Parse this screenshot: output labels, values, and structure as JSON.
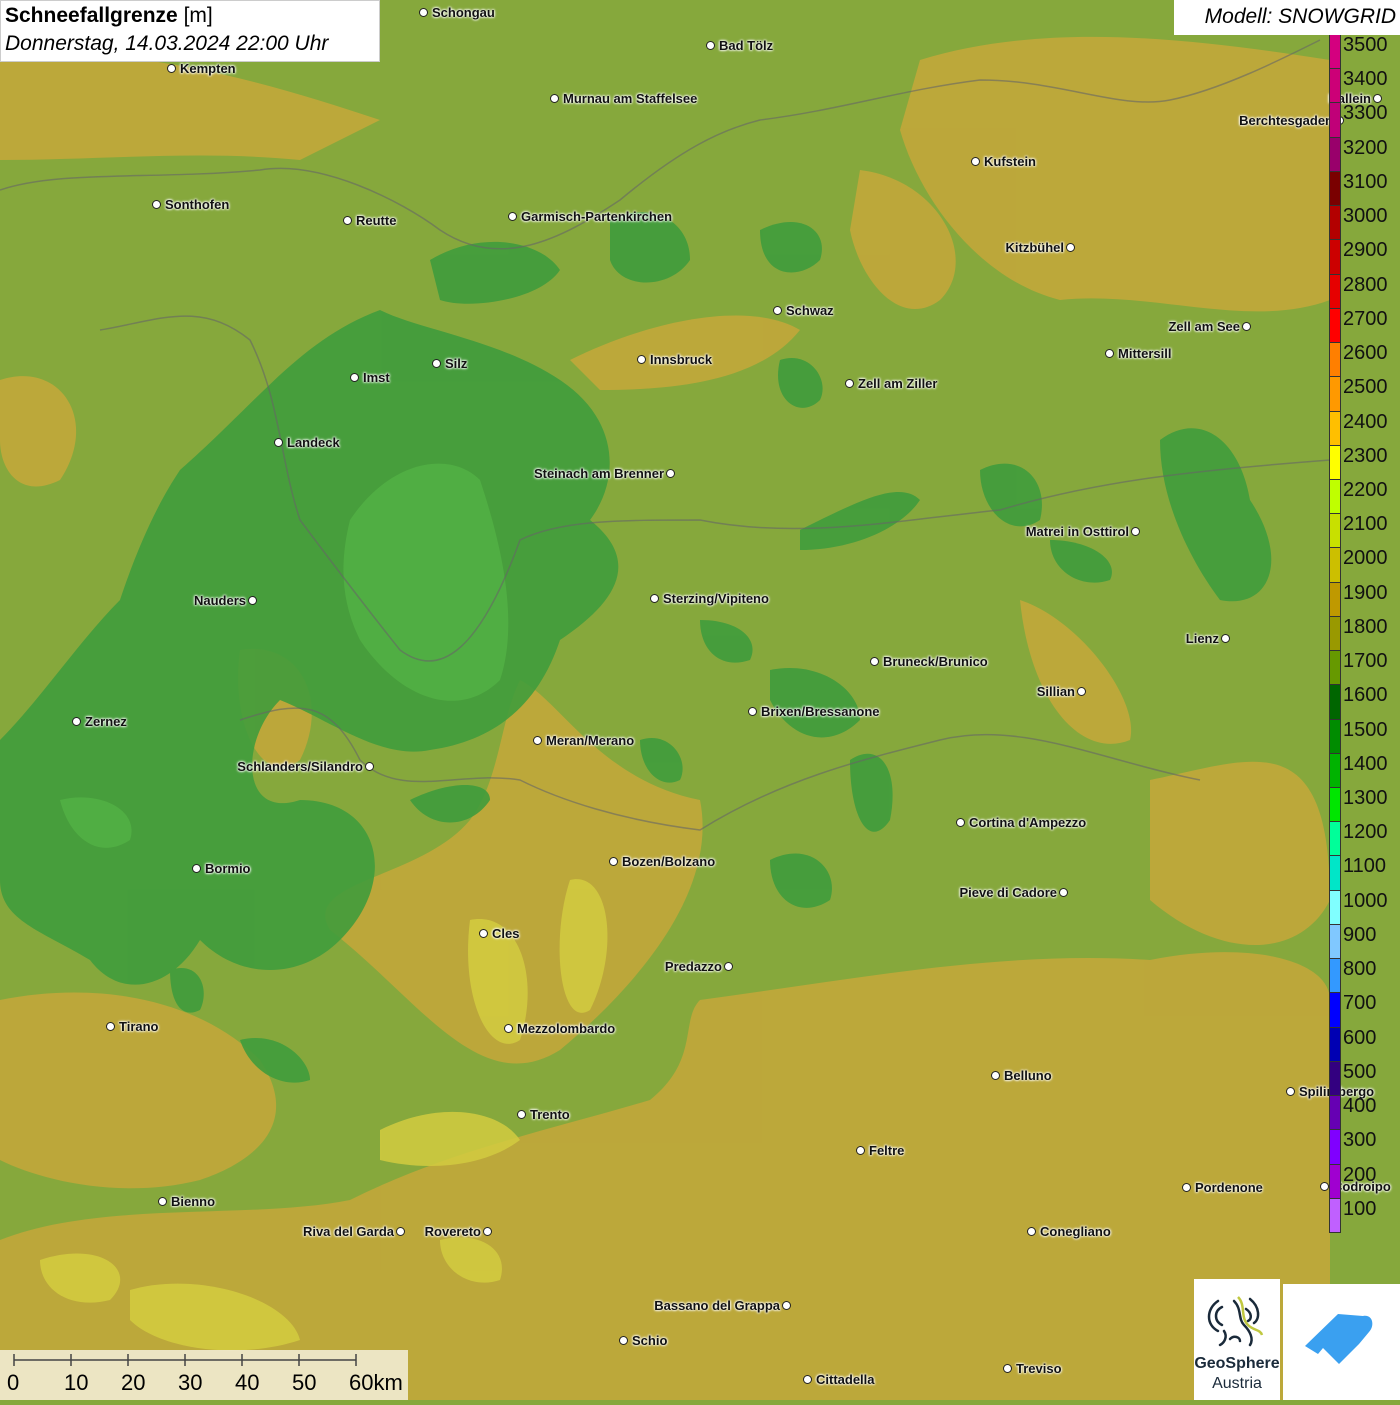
{
  "header": {
    "title": "Schneefallgrenze",
    "unit": "[m]",
    "datetime": "Donnerstag, 14.03.2024 22:00 Uhr",
    "model": "Modell: SNOWGRID"
  },
  "legend": {
    "bins": [
      {
        "label": "3500",
        "color": "#d4007f"
      },
      {
        "label": "3400",
        "color": "#cc0077"
      },
      {
        "label": "3300",
        "color": "#c00078"
      },
      {
        "label": "3200",
        "color": "#99006b"
      },
      {
        "label": "3100",
        "color": "#7a0000"
      },
      {
        "label": "3000",
        "color": "#b30000"
      },
      {
        "label": "2900",
        "color": "#cc0000"
      },
      {
        "label": "2800",
        "color": "#e60000"
      },
      {
        "label": "2700",
        "color": "#ff0000"
      },
      {
        "label": "2600",
        "color": "#ff7f00"
      },
      {
        "label": "2500",
        "color": "#ff9900"
      },
      {
        "label": "2400",
        "color": "#ffbf00"
      },
      {
        "label": "2300",
        "color": "#ffff00"
      },
      {
        "label": "2200",
        "color": "#bfff00"
      },
      {
        "label": "2100",
        "color": "#c8e000"
      },
      {
        "label": "2000",
        "color": "#ccbf00"
      },
      {
        "label": "1900",
        "color": "#bf9900"
      },
      {
        "label": "1800",
        "color": "#999900"
      },
      {
        "label": "1700",
        "color": "#669900"
      },
      {
        "label": "1600",
        "color": "#006600"
      },
      {
        "label": "1500",
        "color": "#008c00"
      },
      {
        "label": "1400",
        "color": "#00b300"
      },
      {
        "label": "1300",
        "color": "#00e600"
      },
      {
        "label": "1200",
        "color": "#00ff99"
      },
      {
        "label": "1100",
        "color": "#00e6c8"
      },
      {
        "label": "1000",
        "color": "#80ffff"
      },
      {
        "label": "900",
        "color": "#80c8ff"
      },
      {
        "label": "800",
        "color": "#3399ff"
      },
      {
        "label": "700",
        "color": "#0000ff"
      },
      {
        "label": "600",
        "color": "#0000b3"
      },
      {
        "label": "500",
        "color": "#330080"
      },
      {
        "label": "400",
        "color": "#6600b3"
      },
      {
        "label": "300",
        "color": "#8000ff"
      },
      {
        "label": "200",
        "color": "#a000d0"
      },
      {
        "label": "100",
        "color": "#c060ff"
      }
    ]
  },
  "cities": [
    "Schongau",
    "Bad Tölz",
    "Kempten",
    "Murnau am Staffelsee",
    "Hallein",
    "Berchtesgaden",
    "Kufstein",
    "Sonthofen",
    "Reutte",
    "Garmisch-Partenkirchen",
    "Kitzbühel",
    "Schwaz",
    "Zell am See",
    "Mittersill",
    "Innsbruck",
    "Silz",
    "Imst",
    "Zell am Ziller",
    "Landeck",
    "Steinach am Brenner",
    "Matrei in Osttirol",
    "Nauders",
    "Sterzing/Vipiteno",
    "Lienz",
    "Bruneck/Brunico",
    "Sillian",
    "Zernez",
    "Brixen/Bressanone",
    "Meran/Merano",
    "Schlanders/Silandro",
    "Cortina d'Ampezzo",
    "Bozen/Bolzano",
    "Bormio",
    "Pieve di Cadore",
    "Cles",
    "Predazzo",
    "Tirano",
    "Mezzolombardo",
    "Belluno",
    "Spilimbergo",
    "Trento",
    "Feltre",
    "Pordenone",
    "Codroipo",
    "Bienno",
    "Riva del Garda",
    "Rovereto",
    "Conegliano",
    "Bassano del Grappa",
    "Schio",
    "Treviso",
    "Cittadella"
  ],
  "scale": {
    "ticks": [
      "0",
      "10",
      "20",
      "30",
      "40",
      "50",
      "60km"
    ]
  },
  "logos": {
    "geosphere_line1": "GeoSphere",
    "geosphere_line2": "Austria"
  },
  "colors": {
    "base": "#86a83c",
    "dark_green": "#3d9a3c",
    "mid_green": "#5fa83a",
    "orange": "#c8a838",
    "yellow": "#d6cf3e"
  }
}
